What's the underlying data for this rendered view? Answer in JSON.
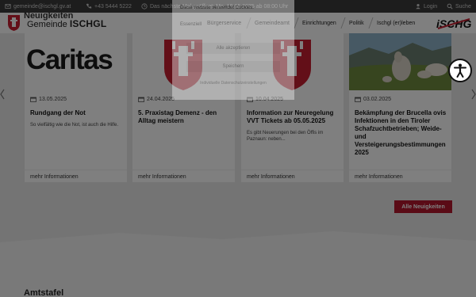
{
  "topbar": {
    "email": "gemeinde@ischgl.gv.at",
    "phone": "+43 5444 5222",
    "notice": "Das nächste Mal geöffnet: Mo, 19.05.2025 ab 08:00 Uhr",
    "login": "Login",
    "search": "Suche"
  },
  "header": {
    "brand_prefix": "Gemeinde",
    "brand_name": "ISCHGL",
    "nav": [
      "Bürgerservice",
      "Gemeindeamt",
      "Einrichtungen",
      "Politik",
      "Ischgl (er)leben"
    ]
  },
  "news": {
    "section_title": "Neuigkeiten",
    "more_label": "mehr Informationen",
    "cards": [
      {
        "date": "13.05.2025",
        "title": "Rundgang der Not",
        "text": "So vielfältig wie die Not, ist auch die Hilfe.",
        "thumb": "Caritas"
      },
      {
        "date": "24.04.2025",
        "title": "5. Praxistag Demenz - den Alltag meistern",
        "text": ""
      },
      {
        "date": "10.04.2025",
        "title": "Information zur Neuregelung VVT Tickets ab 05.05.2025",
        "text": "Es gibt Neuerungen bei den Öffis im Paznaun: neben..."
      },
      {
        "date": "03.02.2025",
        "title": "Bekämpfung der Brucella ovis Infektionen in den Tiroler Schafzuchtbetrieben; Weide- und Versteigerungsbestimmungen 2025",
        "text": ""
      }
    ],
    "all_button": "Alle Neuigkeiten"
  },
  "amtstafel": {
    "title": "Amtstafel"
  },
  "consent": {
    "text": "Diese Website verwendet Cookies.",
    "option": "Essenziell",
    "accept_all": "Alle akzeptieren",
    "save": "Speichern",
    "details": "Individuelle Datenschutzeinstellungen"
  },
  "colors": {
    "brand_red": "#b4172d",
    "topbar": "#3a3a3a",
    "overlay": "rgba(0,0,0,0.5)"
  }
}
